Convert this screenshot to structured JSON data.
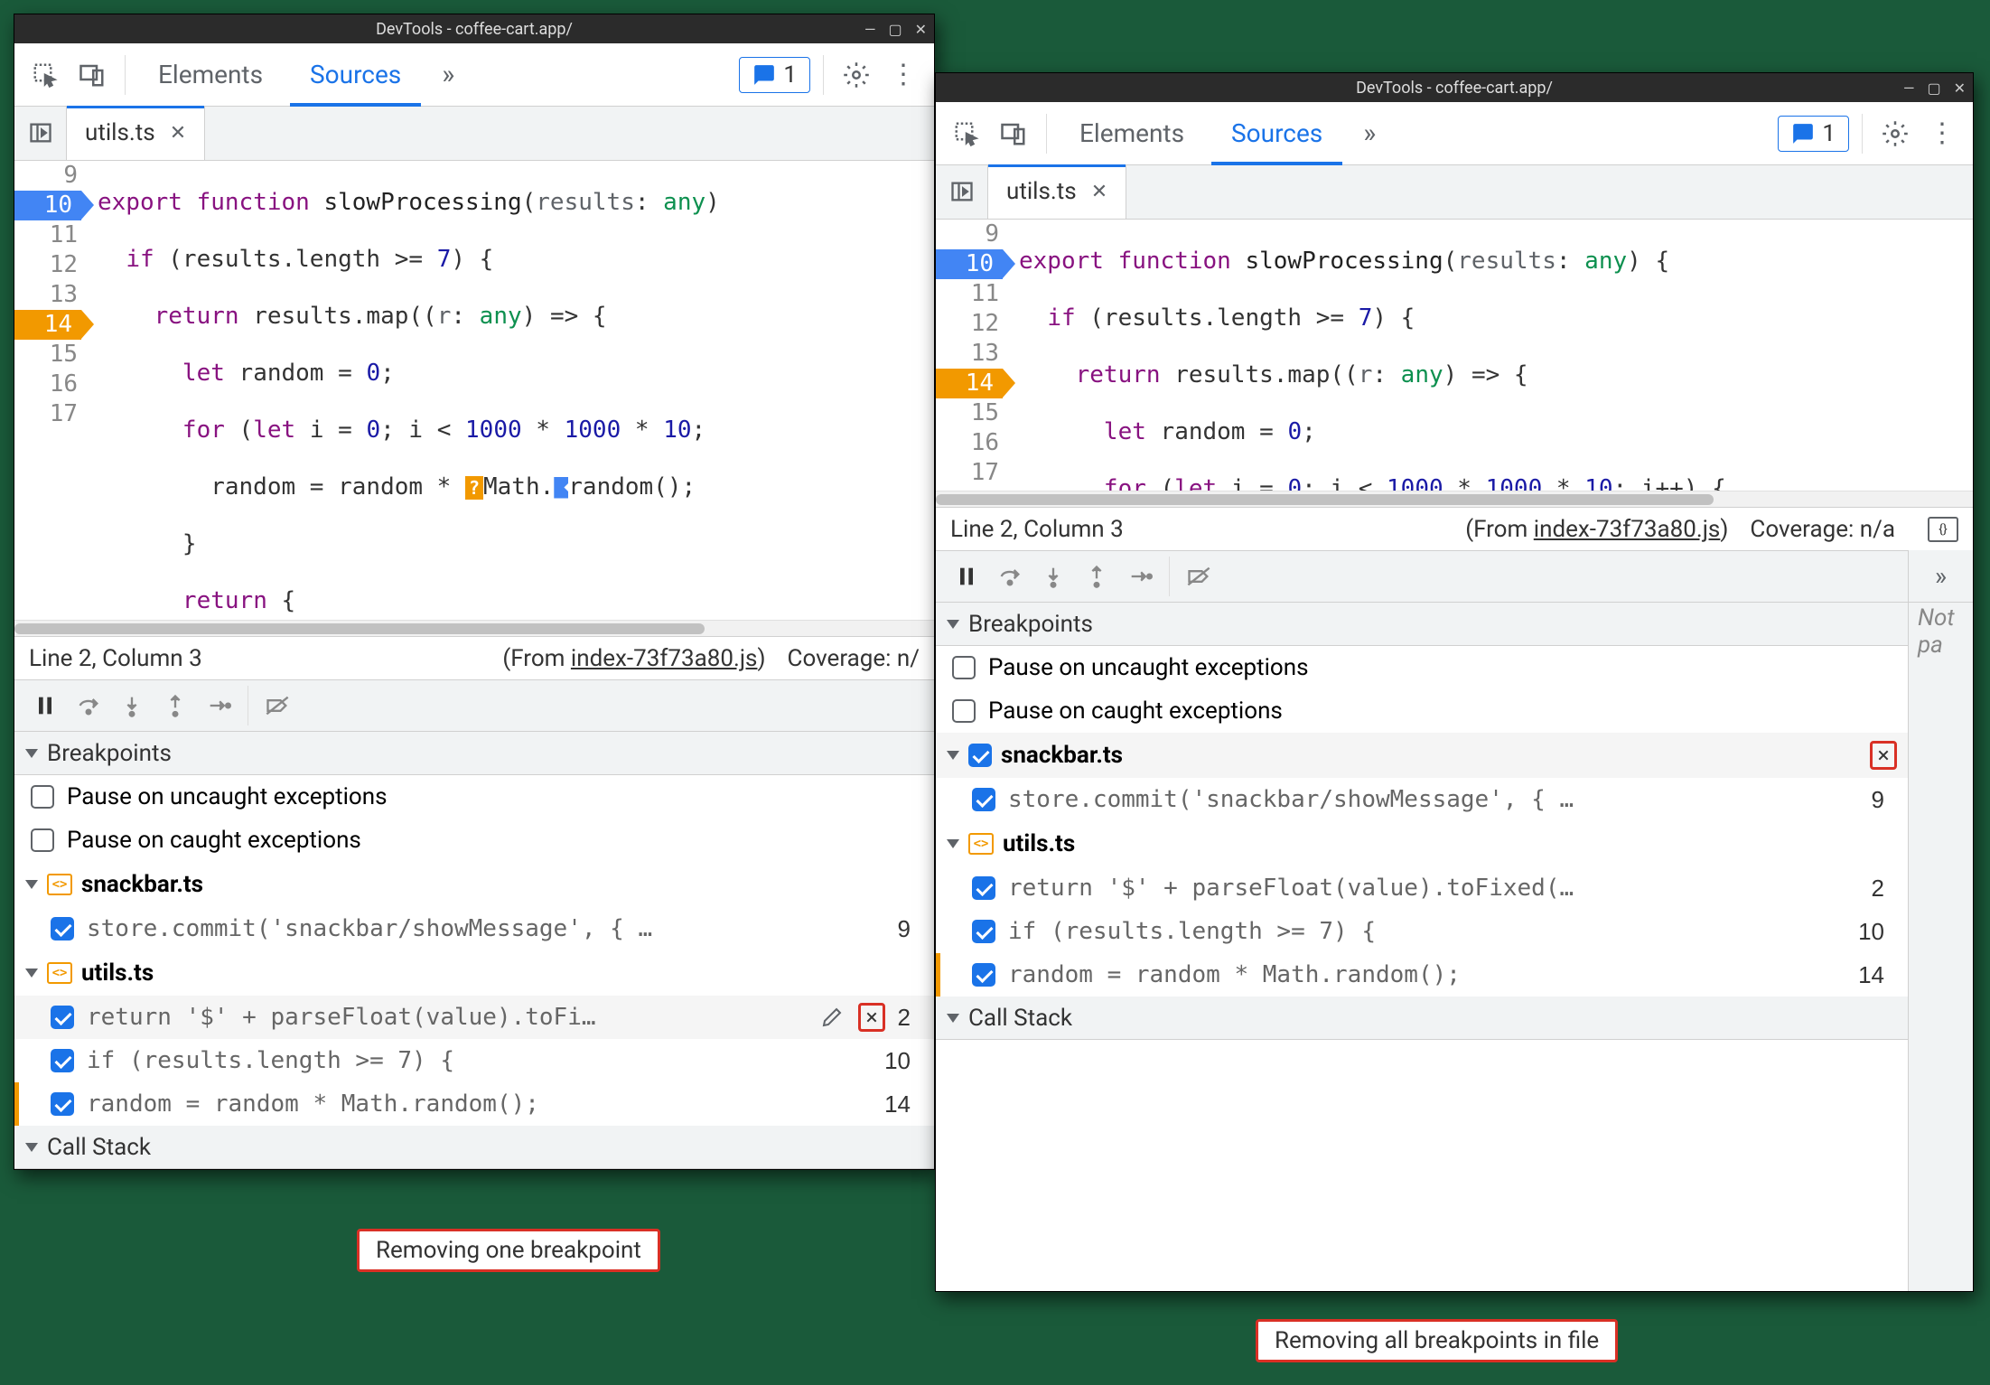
{
  "left": {
    "title": "DevTools - coffee-cart.app/",
    "tabs": {
      "t1": "Elements",
      "t2": "Sources"
    },
    "issue_count": "1",
    "file_tab": "utils.ts",
    "code_lines": [
      "9",
      "10",
      "11",
      "12",
      "13",
      "14",
      "15",
      "16",
      "17"
    ],
    "status": {
      "pos": "Line 2, Column 3",
      "from_prefix": "(From ",
      "from_link": "index-73f73a80.js",
      "from_suffix": ")",
      "cov": "Coverage: n/"
    },
    "bp_header": "Breakpoints",
    "pause_uncaught": "Pause on uncaught exceptions",
    "pause_caught": "Pause on caught exceptions",
    "file1": "snackbar.ts",
    "file1_bp1": "store.commit('snackbar/showMessage', { …",
    "file1_bp1_n": "9",
    "file2": "utils.ts",
    "file2_bp1": "return '$' + parseFloat(value).toFi…",
    "file2_bp1_n": "2",
    "file2_bp2": "if (results.length >= 7) {",
    "file2_bp2_n": "10",
    "file2_bp3": "random = random * Math.random();",
    "file2_bp3_n": "14",
    "callstack": "Call Stack"
  },
  "right": {
    "title": "DevTools - coffee-cart.app/",
    "tabs": {
      "t1": "Elements",
      "t2": "Sources"
    },
    "issue_count": "1",
    "file_tab": "utils.ts",
    "code_lines": [
      "9",
      "10",
      "11",
      "12",
      "13",
      "14",
      "15",
      "16",
      "17"
    ],
    "status": {
      "pos": "Line 2, Column 3",
      "from_prefix": "(From ",
      "from_link": "index-73f73a80.js",
      "from_suffix": ")",
      "cov": "Coverage: n/a"
    },
    "bp_header": "Breakpoints",
    "pause_uncaught": "Pause on uncaught exceptions",
    "pause_caught": "Pause on caught exceptions",
    "file1": "snackbar.ts",
    "file1_bp1": "store.commit('snackbar/showMessage', { …",
    "file1_bp1_n": "9",
    "file2": "utils.ts",
    "file2_bp1": "return '$' + parseFloat(value).toFixed(…",
    "file2_bp1_n": "2",
    "file2_bp2": "if (results.length >= 7) {",
    "file2_bp2_n": "10",
    "file2_bp3": "random = random * Math.random();",
    "file2_bp3_n": "14",
    "callstack": "Call Stack",
    "notpa": "Not pa"
  },
  "caption_left": "Removing one breakpoint",
  "caption_right": "Removing all breakpoints in file"
}
